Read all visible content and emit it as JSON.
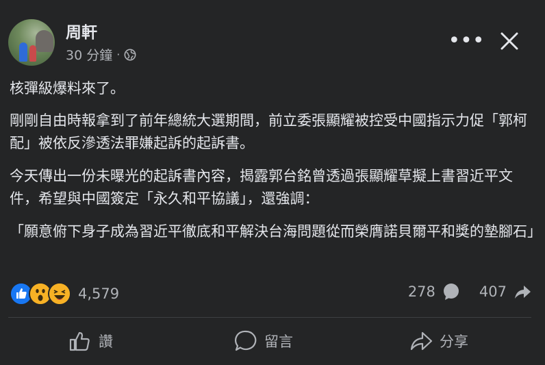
{
  "post": {
    "author": "周軒",
    "time": "30 分鐘",
    "separator": "·",
    "privacy_icon": "globe-icon",
    "more_label": "•••",
    "paragraphs": [
      "核彈級爆料來了。",
      "剛剛自由時報拿到了前年總統大選期間，前立委張顯耀被控受中國指示力促「郭柯配」被依反滲透法罪嫌起訴的起訴書。",
      "今天傳出一份未曝光的起訴書內容，揭露郭台銘曾透過張顯耀草擬上書習近平文件，希望與中國簽定「永久和平協議」，還強調：",
      "「願意俯下身子成為習近平徹底和平解決台海問題從而榮膺諾貝爾平和獎的墊腳石」"
    ],
    "reactions": {
      "icons": [
        "like-icon",
        "wow-icon",
        "haha-icon"
      ],
      "count": "4,579"
    },
    "comments_count": "278",
    "shares_count": "407",
    "actions": {
      "like": "讚",
      "comment": "留言",
      "share": "分享"
    }
  },
  "colors": {
    "background": "#242526",
    "text": "#e4e6eb",
    "secondary": "#b0b3b8",
    "like_blue": "#1877f2",
    "emoji_yellow": "#f7b125"
  }
}
